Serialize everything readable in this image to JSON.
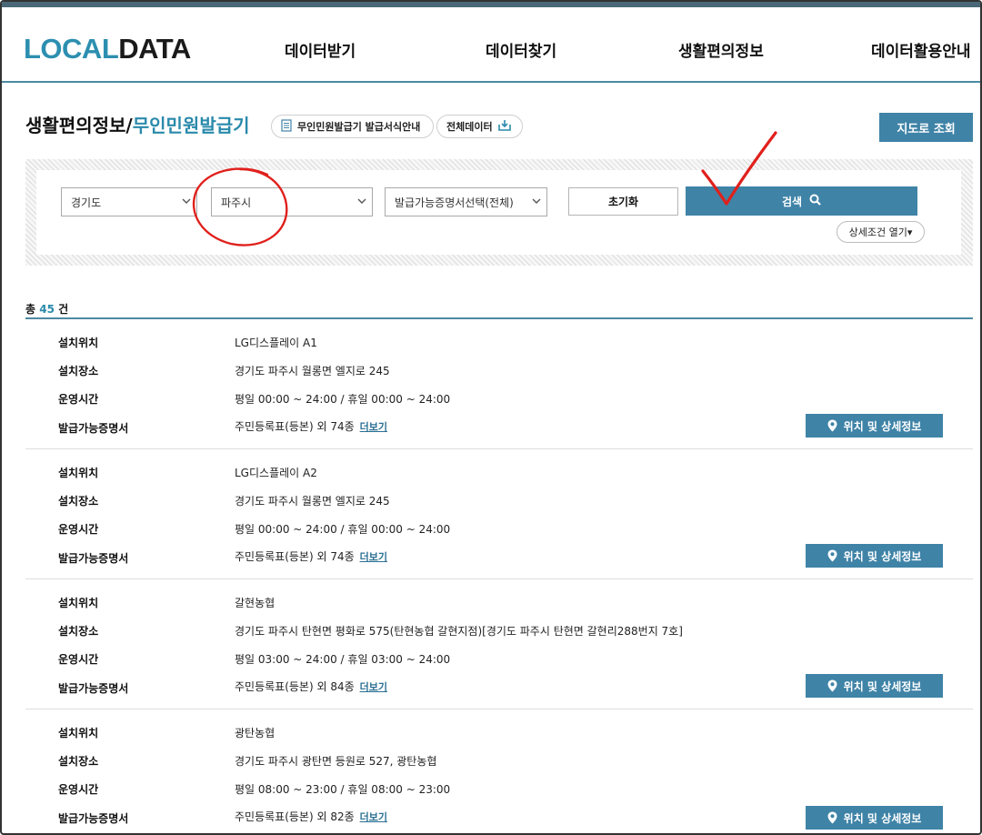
{
  "header": {
    "logo_part1": "LOCAL",
    "logo_part2": "DATA",
    "nav": [
      "데이터받기",
      "데이터찾기",
      "생활편의정보",
      "데이터활용안내"
    ]
  },
  "title": {
    "main": "생활편의정보/",
    "accent": "무인민원발급기",
    "guide_button": "무인민원발급기 발급서식안내",
    "all_data_button": "전체데이터",
    "map_button": "지도로 조회"
  },
  "search": {
    "region": "경기도",
    "city": "파주시",
    "certificate": "발급가능증명서선택(전체)",
    "reset_label": "초기화",
    "search_label": "검색",
    "detail_toggle": "상세조건 열기▾"
  },
  "results": {
    "total_prefix": "총",
    "total_count": "45",
    "total_suffix": "건",
    "labels": {
      "location": "설치위치",
      "place": "설치장소",
      "hours": "운영시간",
      "certs": "발급가능증명서"
    },
    "more_label": "더보기",
    "detail_button": "위치 및 상세정보",
    "items": [
      {
        "location": "LG디스플레이 A1",
        "place": "경기도 파주시 월롱면 엘지로 245",
        "hours": "평일 00:00 ~ 24:00 / 휴일 00:00 ~ 24:00",
        "certs": "주민등록표(등본) 외 74종"
      },
      {
        "location": "LG디스플레이 A2",
        "place": "경기도 파주시 월롱면 엘지로 245",
        "hours": "평일 00:00 ~ 24:00 / 휴일 00:00 ~ 24:00",
        "certs": "주민등록표(등본) 외 74종"
      },
      {
        "location": "갈현농협",
        "place": "경기도 파주시 탄현면 평화로 575(탄현농협 갈현지점)[경기도 파주시 탄현면 갈현리288번지 7호]",
        "hours": "평일 03:00 ~ 24:00 / 휴일 03:00 ~ 24:00",
        "certs": "주민등록표(등본) 외 84종"
      },
      {
        "location": "광탄농협",
        "place": "경기도 파주시 광탄면 등원로 527, 광탄농협",
        "hours": "평일 08:00 ~ 23:00 / 휴일 08:00 ~ 23:00",
        "certs": "주민등록표(등본) 외 82종"
      }
    ]
  },
  "colors": {
    "accent": "#3f83a7",
    "teal_text": "#2a8aab",
    "annotation": "#e0201c"
  }
}
